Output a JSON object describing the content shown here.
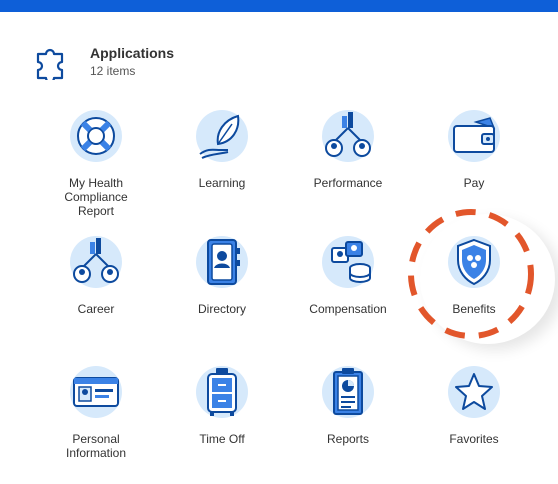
{
  "header": {
    "title": "Applications",
    "count": "12 items",
    "icon": "puzzle-icon"
  },
  "apps": [
    {
      "label_lines": [
        "My Health",
        "Compliance",
        "Report"
      ],
      "icon": "life-ring-icon"
    },
    {
      "label_lines": [
        "Learning"
      ],
      "icon": "leaf-hand-icon"
    },
    {
      "label_lines": [
        "Performance"
      ],
      "icon": "people-chart-icon"
    },
    {
      "label_lines": [
        "Pay"
      ],
      "icon": "wallet-icon"
    },
    {
      "label_lines": [
        "Career"
      ],
      "icon": "people-chart-icon"
    },
    {
      "label_lines": [
        "Directory"
      ],
      "icon": "address-book-icon"
    },
    {
      "label_lines": [
        "Compensation"
      ],
      "icon": "people-coins-icon"
    },
    {
      "label_lines": [
        "Benefits"
      ],
      "icon": "shield-icon"
    },
    {
      "label_lines": [
        "Personal",
        "Information"
      ],
      "icon": "id-card-icon"
    },
    {
      "label_lines": [
        "Time Off"
      ],
      "icon": "suitcase-icon"
    },
    {
      "label_lines": [
        "Reports"
      ],
      "icon": "clipboard-chart-icon"
    },
    {
      "label_lines": [
        "Favorites"
      ],
      "icon": "star-icon"
    }
  ],
  "colors": {
    "brand_bar": "#0e5fd8",
    "icon_bg": "#d6e9fb",
    "icon_stroke": "#0d4a9e",
    "icon_fill": "#3b82e6",
    "highlight": "#e2562b"
  }
}
